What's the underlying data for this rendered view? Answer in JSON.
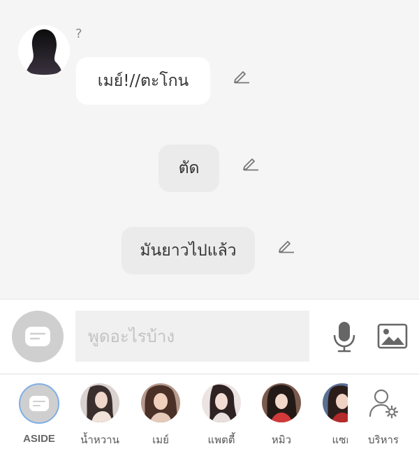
{
  "chat": {
    "sender_name": "?",
    "messages": [
      {
        "text": "เมย์!//ตะโกน",
        "style": "white"
      },
      {
        "text": "ตัด",
        "style": "grey"
      },
      {
        "text": "มันยาวไปแล้ว",
        "style": "grey"
      }
    ]
  },
  "composer": {
    "placeholder": "พูดอะไรบ้าง",
    "icons": [
      "chat-bubble-icon",
      "microphone-icon",
      "image-icon"
    ]
  },
  "characters": [
    {
      "label": "ASIDE",
      "icon": "chat-bubble-icon",
      "selected": true
    },
    {
      "label": "น้ำหวาน"
    },
    {
      "label": "เมย์"
    },
    {
      "label": "แพตตี้"
    },
    {
      "label": "หมิว"
    },
    {
      "label": "แซก"
    },
    {
      "label": "บริหาร",
      "icon": "user-settings-icon"
    }
  ],
  "colors": {
    "chat_background": "#f5f5f5",
    "bubble_white": "#ffffff",
    "bubble_grey": "#ebebeb",
    "accent_ring": "#7faee6",
    "placeholder": "#c3c3c3"
  }
}
